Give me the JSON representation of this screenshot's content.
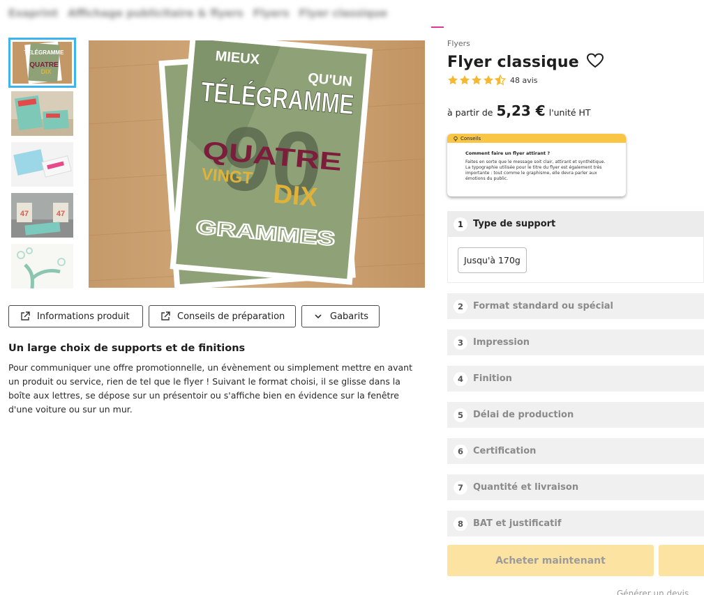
{
  "breadcrumb": [
    "Exaprint",
    "Affichage publicitaire & flyers",
    "Flyers",
    "Flyer classique"
  ],
  "gallery": {
    "thumbnails": [
      {
        "name": "flyer-telegramme"
      },
      {
        "name": "flyers-stack-red"
      },
      {
        "name": "flyers-blue-pink"
      },
      {
        "name": "flyers-47"
      },
      {
        "name": "flyer-tree"
      }
    ],
    "main_flyer": {
      "line1_left": "MIEUX",
      "line1_right": "QU'UN",
      "headline": "TÉLÉGRAMME",
      "big_number": "90",
      "word1": "QUATRE",
      "word2": "VINGT",
      "word3": "DIX",
      "footer": "GRAMMES"
    }
  },
  "actions": {
    "info": "Informations produit",
    "prep": "Conseils de préparation",
    "templates": "Gabarits"
  },
  "description": {
    "title": "Un large choix de supports et de finitions",
    "text": "Pour communiquer une offre promotionnelle, un évènement ou simplement mettre en avant un produit ou service, rien de tel que le flyer ! Suivant le format choisi, il se glisse dans la boîte aux lettres, se dépose sur un présentoir ou s'affiche bien en évidence sur la fenêtre d'une voiture ou sur un mur."
  },
  "product": {
    "category": "Flyers",
    "title": "Flyer classique",
    "rating_value": 4.5,
    "reviews": "48 avis",
    "price_prefix": "à partir de",
    "price": "5,23 €",
    "price_suffix": "l'unité HT"
  },
  "tips": {
    "label": "Conseils",
    "title": "Comment faire un flyer attirant ?",
    "body": "Faites en sorte que le message soit clair, attirant et synthétique. La typographie utilisée pour le titre du flyer est également très importante : tout comme le graphisme, elle devra parler aux émotions du public."
  },
  "steps": [
    {
      "num": "1",
      "label": "Type de support"
    },
    {
      "num": "2",
      "label": "Format standard ou spécial"
    },
    {
      "num": "3",
      "label": "Impression"
    },
    {
      "num": "4",
      "label": "Finition"
    },
    {
      "num": "5",
      "label": "Délai de production"
    },
    {
      "num": "6",
      "label": "Certification"
    },
    {
      "num": "7",
      "label": "Quantité et livraison"
    },
    {
      "num": "8",
      "label": "BAT et justificatif"
    }
  ],
  "step1_option": "Jusqu'à 170g",
  "buy_label": "Acheter maintenant",
  "quote_label": "Générer un devis",
  "colors": {
    "accent_yellow": "#f8c545",
    "thumb_selected": "#3db4ef",
    "flyer_green": "#8fa277",
    "flyer_red": "#7c1d3c",
    "flyer_gold": "#e0b23a"
  }
}
